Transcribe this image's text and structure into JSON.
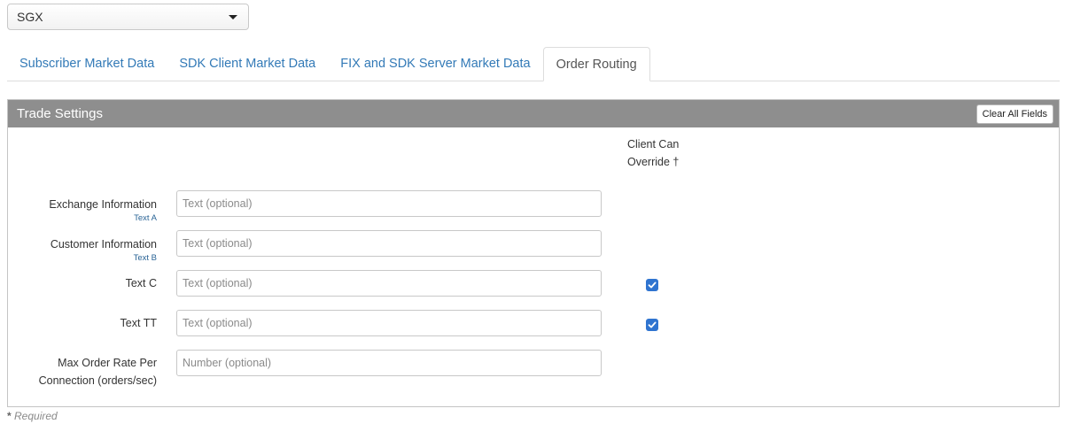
{
  "exchange_select": {
    "value": "SGX",
    "icon": "chevron-down-icon"
  },
  "tabs": [
    {
      "label": "Subscriber Market Data",
      "active": false
    },
    {
      "label": "SDK Client Market Data",
      "active": false
    },
    {
      "label": "FIX and SDK Server Market Data",
      "active": false
    },
    {
      "label": "Order Routing",
      "active": true
    }
  ],
  "panel": {
    "title": "Trade Settings",
    "clear_button": "Clear All Fields",
    "override_header_line1": "Client Can",
    "override_header_line2": "Override †",
    "rows": [
      {
        "label": "Exchange Information",
        "sublabel": "Text A",
        "placeholder": "Text (optional)",
        "override_checked": null
      },
      {
        "label": "Customer Information",
        "sublabel": "Text B",
        "placeholder": "Text (optional)",
        "override_checked": null
      },
      {
        "label": "Text C",
        "sublabel": "",
        "placeholder": "Text (optional)",
        "override_checked": true
      },
      {
        "label": "Text TT",
        "sublabel": "",
        "placeholder": "Text (optional)",
        "override_checked": true
      },
      {
        "label_line1": "Max Order Rate Per",
        "label_line2": "Connection (orders/sec)",
        "placeholder": "Number (optional)",
        "override_checked": null
      }
    ]
  },
  "footer": {
    "required_marker": "*",
    "required_text": "Required"
  },
  "colors": {
    "accent": "#337ab7",
    "header_bg": "#8e8e8e",
    "checkbox": "#2f74d0"
  }
}
